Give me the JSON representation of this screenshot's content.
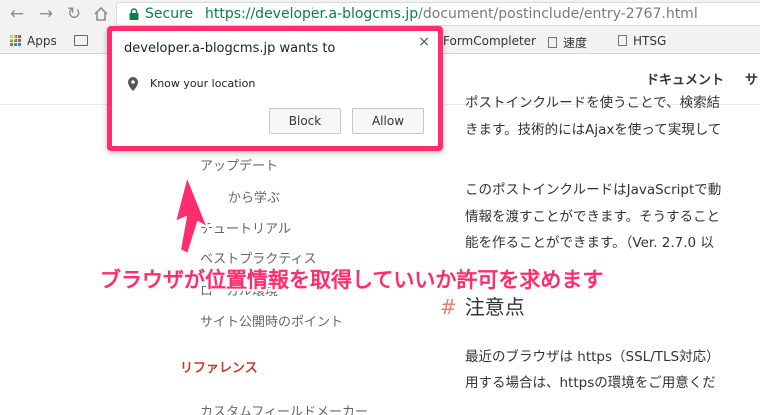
{
  "browser": {
    "secure_label": "Secure",
    "url_host": "https://developer.a-blogcms.jp",
    "url_path": "/document/postinclude/entry-2767.html"
  },
  "bookmarks": [
    {
      "label": "Apps"
    },
    {
      "label": "FormCompleter"
    },
    {
      "label": "速度"
    },
    {
      "label": "HTSG"
    }
  ],
  "topnav": {
    "items": [
      "ドキュメント",
      "サ"
    ]
  },
  "sidebar": {
    "items": [
      "アップデート",
      "から学ぶ",
      "チュートリアル",
      "ベストプラクティス",
      "ローカル環境",
      "サイト公開時のポイント",
      "カスタムフィールドメーカー"
    ],
    "heading": "リファレンス"
  },
  "article": {
    "lines_top": [
      "ポストインクルードを使うことで、検索結",
      "きます。技術的にはAjaxを使って実現して"
    ],
    "lines_mid": [
      "このポストインクルードはJavaScriptで動",
      "情報を渡すことができます。そうすること",
      "能を作ることができます。（Ver. 2.7.0 以"
    ],
    "heading_hash": "#",
    "heading": "注意点",
    "lines_bottom": [
      "最近のブラウザは https（SSL/TLS対応）",
      "用する場合は、httpsの環境をご用意くだ"
    ]
  },
  "dialog": {
    "title": "developer.a-blogcms.jp wants to",
    "close": "×",
    "message": "Know your location",
    "block_label": "Block",
    "allow_label": "Allow"
  },
  "annotation": {
    "text": "ブラウザが位置情報を取得していいか許可を求めます",
    "color": "#ff2d6d"
  }
}
